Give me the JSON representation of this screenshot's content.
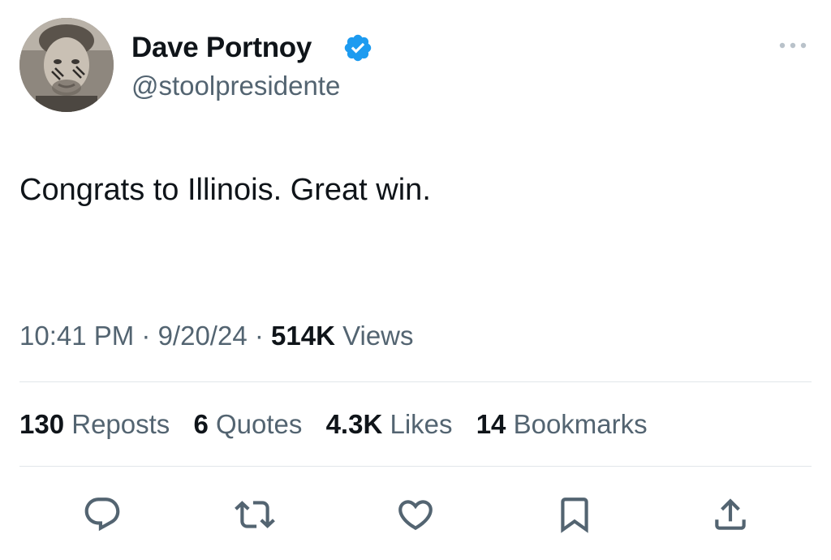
{
  "author": {
    "display_name": "Dave Portnoy",
    "handle": "@stoolpresidente",
    "verified_color": "#1d9bf0"
  },
  "tweet": {
    "text": "Congrats to Illinois.  Great win."
  },
  "meta": {
    "time": "10:41 PM",
    "separator": " · ",
    "date": "9/20/24",
    "views_count": "514K",
    "views_label": "Views"
  },
  "stats": {
    "reposts_count": "130",
    "reposts_label": "Reposts",
    "quotes_count": "6",
    "quotes_label": "Quotes",
    "likes_count": "4.3K",
    "likes_label": "Likes",
    "bookmarks_count": "14",
    "bookmarks_label": "Bookmarks"
  },
  "icons": {
    "verified": "verified-badge-icon",
    "more": "more-options-icon",
    "reply": "reply-icon",
    "repost": "repost-icon",
    "like": "heart-icon",
    "bookmark": "bookmark-icon",
    "share": "share-icon"
  },
  "colors": {
    "text_primary": "#0f1419",
    "text_secondary": "#536471",
    "divider": "#e1e6ea"
  }
}
